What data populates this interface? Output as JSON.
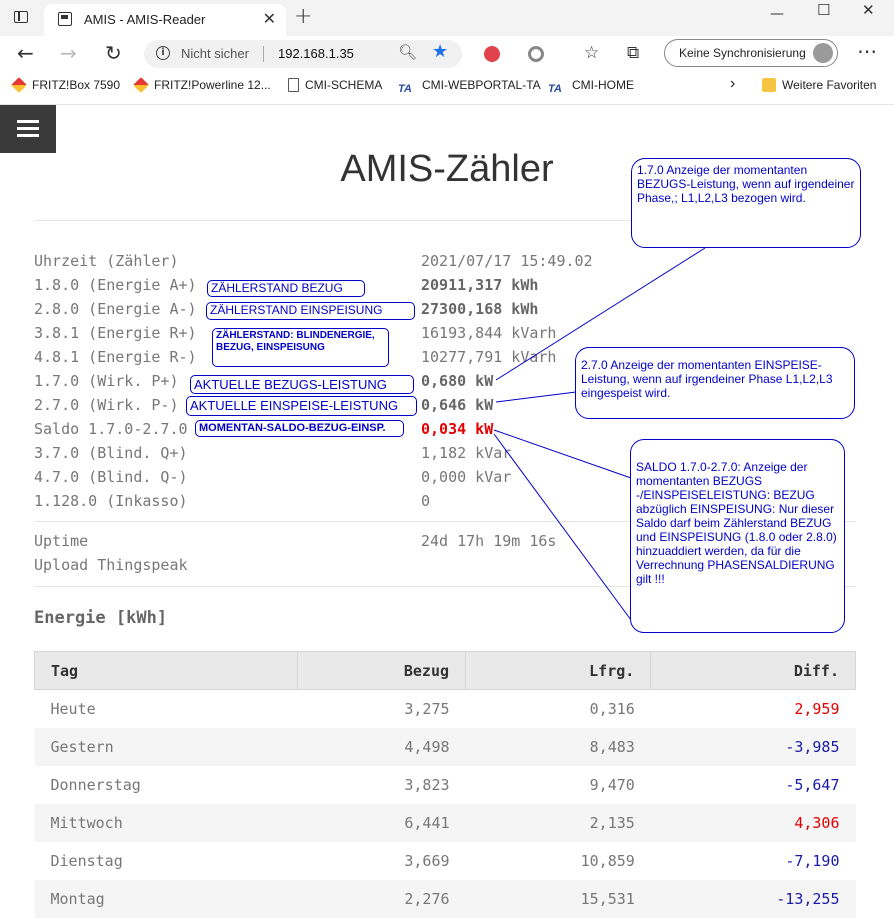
{
  "browser": {
    "tab_title": "AMIS - AMIS-Reader",
    "security_label": "Nicht sicher",
    "url": "192.168.1.35",
    "sync_label": "Keine Synchronisierung",
    "bookmarks": [
      "FRITZ!Box 7590",
      "FRITZ!Powerline 12...",
      "CMI-SCHEMA",
      "CMI-WEBPORTAL-TA",
      "CMI-HOME"
    ],
    "more_favorites": "Weitere Favoriten"
  },
  "page": {
    "title": "AMIS-Zähler",
    "readings": [
      {
        "label": "Uhrzeit (Zähler)",
        "value": "2021/07/17 15:49.02"
      },
      {
        "label": "1.8.0 (Energie A+)",
        "value": "20911,317 kWh"
      },
      {
        "label": "2.8.0 (Energie A-)",
        "value": "27300,168 kWh"
      },
      {
        "label": "3.8.1 (Energie R+)",
        "value": "16193,844 kVarh"
      },
      {
        "label": "4.8.1 (Energie R-)",
        "value": "10277,791 kVarh"
      },
      {
        "label": "1.7.0 (Wirk. P+)",
        "value": "0,680 kW"
      },
      {
        "label": "2.7.0 (Wirk. P-)",
        "value": "0,646 kW"
      },
      {
        "label": "Saldo 1.7.0-2.7.0",
        "value": "0,034 kW"
      },
      {
        "label": "3.7.0 (Blind. Q+)",
        "value": "1,182 kVar"
      },
      {
        "label": "4.7.0 (Blind. Q-)",
        "value": "0,000 kVar"
      },
      {
        "label": "1.128.0 (Inkasso)",
        "value": "0"
      }
    ],
    "uptime_label": "Uptime",
    "uptime_value": "24d 17h 19m 16s",
    "upload_label": "Upload Thingspeak",
    "energy_title": "Energie [kWh]",
    "table": {
      "headers": [
        "Tag",
        "Bezug",
        "Lfrg.",
        "Diff."
      ],
      "rows": [
        [
          "Heute",
          "3,275",
          "0,316",
          "2,959"
        ],
        [
          "Gestern",
          "4,498",
          "8,483",
          "-3,985"
        ],
        [
          "Donnerstag",
          "3,823",
          "9,470",
          "-5,647"
        ],
        [
          "Mittwoch",
          "6,441",
          "2,135",
          "4,306"
        ],
        [
          "Dienstag",
          "3,669",
          "10,859",
          "-7,190"
        ],
        [
          "Montag",
          "2,276",
          "15,531",
          "-13,255"
        ]
      ]
    }
  },
  "annotations": {
    "labels": [
      "ZÄHLERSTAND BEZUG",
      "ZÄHLERSTAND EINSPEISUNG",
      "ZÄHLERSTAND: BLINDENERGIE, BEZUG, EINSPEISUNG",
      "AKTUELLE BEZUGS-LEISTUNG",
      "AKTUELLE EINSPEISE-LEISTUNG",
      "MOMENTAN-SALDO-BEZUG-EINSP."
    ],
    "callouts": [
      "1.7.0 Anzeige der momentanten BEZUGS-Leistung, wenn auf irgendeiner Phase,; L1,L2,L3 bezogen wird.",
      "2.7.0 Anzeige der momentanten EINSPEISE-Leistung, wenn auf irgendeiner Phase L1,L2,L3 eingespeist wird.",
      "SALDO 1.7.0-2.7.0: Anzeige der momentanten BEZUGS -/EINSPEISELEISTUNG: BEZUG abzüglich EINSPEISUNG: Nur dieser Saldo darf beim Zählerstand BEZUG und EINSPEISUNG (1.8.0 oder 2.8.0) hinzuaddiert werden, da für die Verrechnung PHASENSALDIERUNG gilt !!!"
    ]
  },
  "colors": {
    "positive": "#e40000",
    "negative": "#1a1aa8",
    "annotation": "#0000c8",
    "menu_bg": "#3a3a3a"
  }
}
